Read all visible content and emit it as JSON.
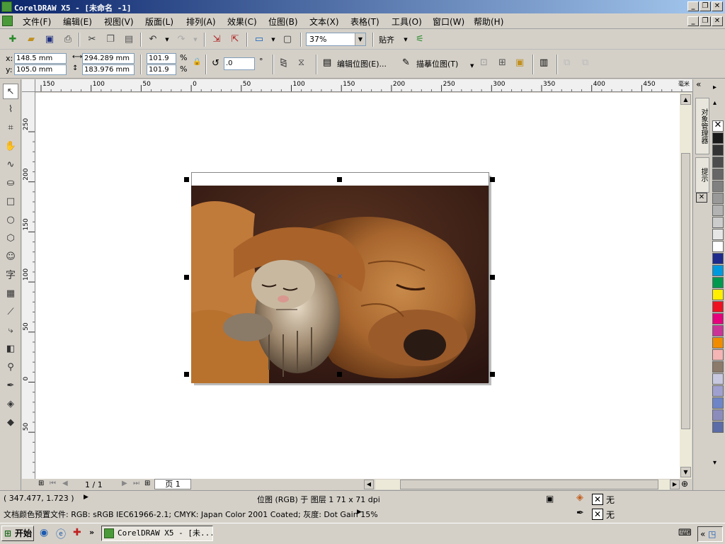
{
  "window": {
    "title": "CorelDRAW X5 - [未命名 -1]"
  },
  "menu": [
    {
      "label": "文件(F)"
    },
    {
      "label": "编辑(E)"
    },
    {
      "label": "视图(V)"
    },
    {
      "label": "版面(L)"
    },
    {
      "label": "排列(A)"
    },
    {
      "label": "效果(C)"
    },
    {
      "label": "位图(B)"
    },
    {
      "label": "文本(X)"
    },
    {
      "label": "表格(T)"
    },
    {
      "label": "工具(O)"
    },
    {
      "label": "窗口(W)"
    },
    {
      "label": "帮助(H)"
    }
  ],
  "toolbar": {
    "zoom": "37%",
    "snap_label": "贴齐"
  },
  "propbar": {
    "x_label": "x:",
    "y_label": "y:",
    "x_value": "148.5 mm",
    "y_value": "105.0 mm",
    "width_value": "294.289 mm",
    "height_value": "183.976 mm",
    "scale_x": "101.9",
    "scale_y": "101.9",
    "percent": "%",
    "rotation": ".0",
    "degree": "°",
    "edit_bitmap": "编辑位图(E)...",
    "trace_bitmap": "描摹位图(T)"
  },
  "ruler": {
    "unit": "毫米",
    "h_ticks": [
      "150",
      "100",
      "50",
      "0",
      "50",
      "100",
      "150",
      "200",
      "250",
      "300",
      "350",
      "400",
      "450"
    ],
    "v_ticks": [
      "250",
      "200",
      "150",
      "100",
      "50",
      "0",
      "50"
    ]
  },
  "docker": {
    "tab1": "对象管理器",
    "tab2": "提示"
  },
  "page_nav": {
    "count": "1 / 1",
    "page_tab": "页 1"
  },
  "status": {
    "coords": "( 347.477, 1.723 )",
    "object_info": "位图 (RGB) 于 图层 1 71 x 71 dpi",
    "fill_none": "无",
    "outline_none": "无",
    "color_profile": "文档颜色预置文件: RGB: sRGB IEC61966-2.1; CMYK: Japan Color 2001 Coated; 灰度: Dot Gain 15%"
  },
  "taskbar": {
    "start_label": "开始",
    "task_label": "CorelDRAW X5 - [未..."
  },
  "palette_colors": [
    "#1a1a1a",
    "#333333",
    "#4d4d4d",
    "#666666",
    "#808080",
    "#999999",
    "#b3b3b3",
    "#cccccc",
    "#e6e6e6",
    "#ffffff",
    "#1e2a8c",
    "#0099dd",
    "#00994d",
    "#ffee00",
    "#ee1122",
    "#e6007e",
    "#cc3399",
    "#f08c00",
    "#f5b5b5",
    "#8c7a6a",
    "#c8c8e0",
    "#a0a0d0",
    "#6e86c8",
    "#8c8cbc",
    "#5c6ca8"
  ]
}
